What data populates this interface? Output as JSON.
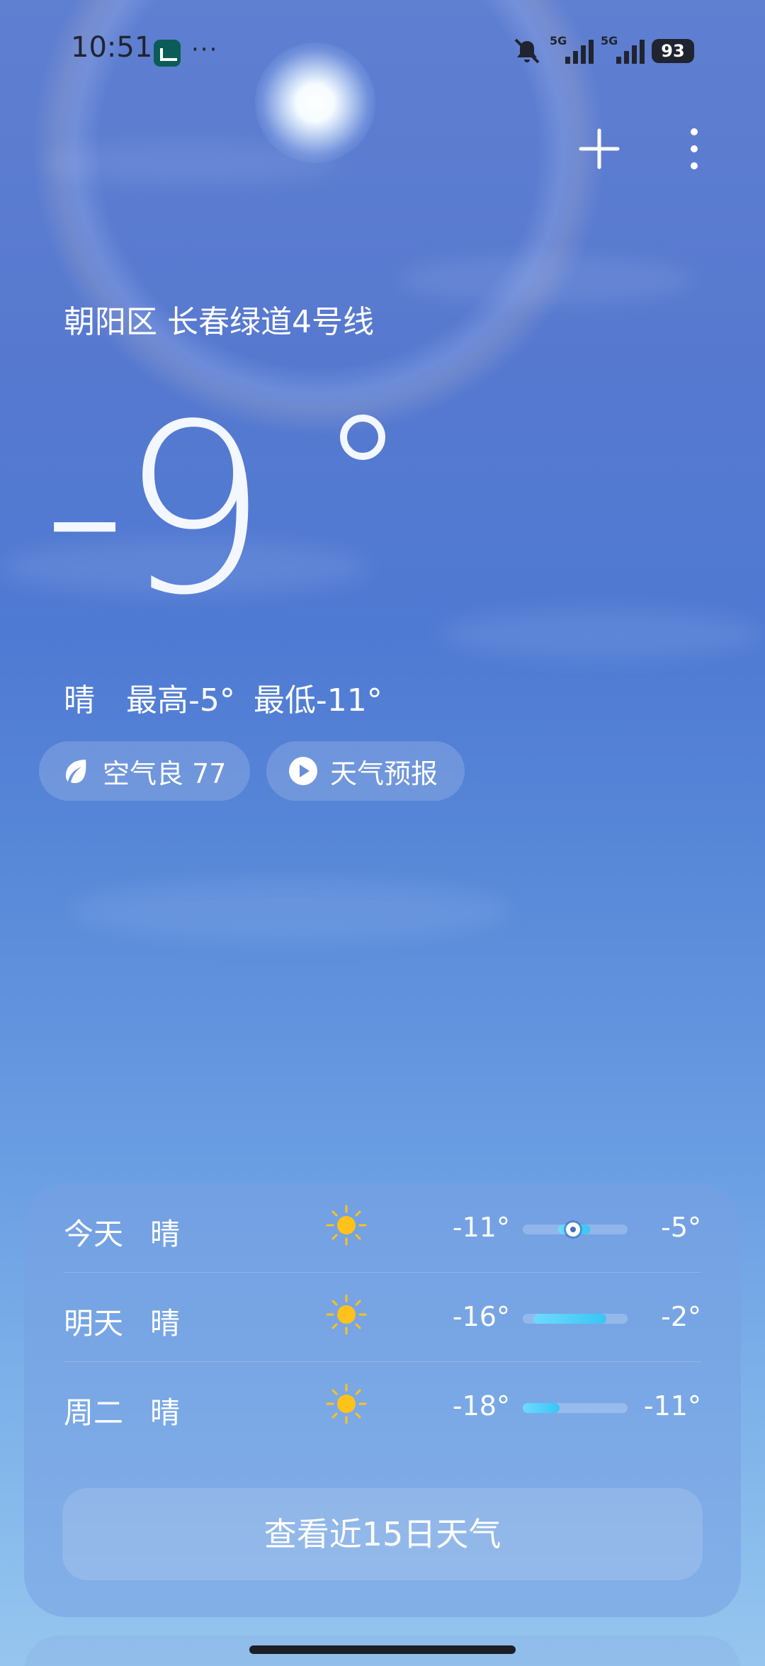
{
  "status_bar": {
    "time": "10:51",
    "notification_more": "···",
    "signal_1_tag": "5G",
    "signal_2_tag": "5G",
    "battery": "93"
  },
  "location": "朝阳区 长春绿道4号线",
  "current": {
    "temperature": "-9",
    "condition": "晴",
    "high": "最高-5°",
    "low": "最低-11°"
  },
  "chips": {
    "aqi": "空气良 77",
    "forecast": "天气预报"
  },
  "daily": [
    {
      "day": "今天",
      "condition": "晴",
      "icon": "sun-icon",
      "min": "-11°",
      "max": "-5°",
      "bar_start": 0.34,
      "bar_end": 0.64,
      "current_marker": 0.48
    },
    {
      "day": "明天",
      "condition": "晴",
      "icon": "sun-icon",
      "min": "-16°",
      "max": "-2°",
      "bar_start": 0.1,
      "bar_end": 0.8
    },
    {
      "day": "周二",
      "condition": "晴",
      "icon": "sun-icon",
      "min": "-18°",
      "max": "-11°",
      "bar_start": 0.0,
      "bar_end": 0.35
    }
  ],
  "cta_label": "查看近15日天气",
  "colors": {
    "bar_fill": "#38c6f5",
    "sun_yellow": "#ffc21a"
  }
}
